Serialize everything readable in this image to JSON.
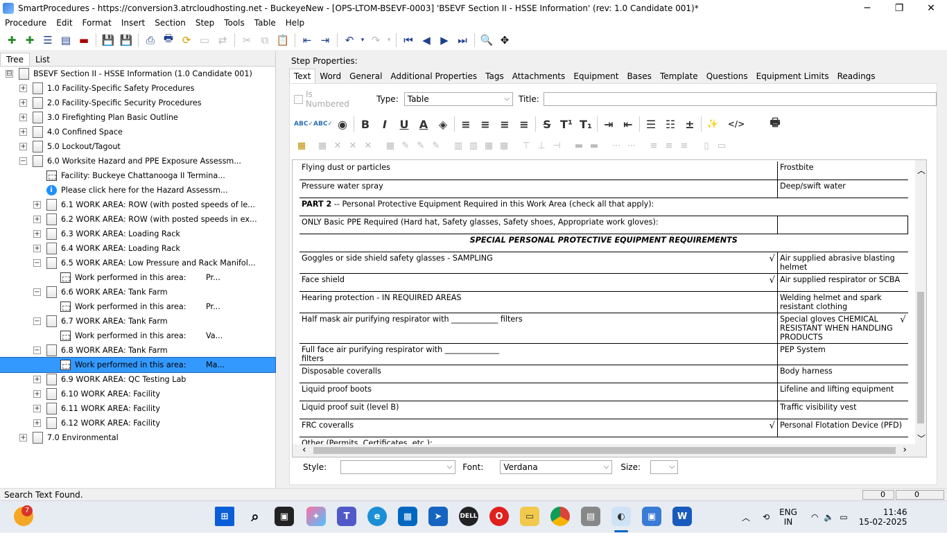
{
  "window": {
    "title": "SmartProcedures - https://conversion3.atrcloudhosting.net - BuckeyeNew - [OPS-LTOM-BSEVF-0003] 'BSEVF Section II - HSSE Information' (rev: 1.0 Candidate 001)*",
    "minimize": "─",
    "restore": "❐",
    "close": "✕"
  },
  "menu": [
    "Procedure",
    "Edit",
    "Format",
    "Insert",
    "Section",
    "Step",
    "Tools",
    "Table",
    "Help"
  ],
  "left_tabs": [
    "Tree",
    "List"
  ],
  "tree": [
    {
      "label": "BSEVF Section II - HSSE Information (1.0 Candidate 001)",
      "level": 0,
      "exp": "⊟",
      "icon": "doc"
    },
    {
      "label": "1.0 Facility-Specific Safety Procedures",
      "level": 1,
      "exp": "+",
      "icon": "doc"
    },
    {
      "label": "2.0 Facility-Specific Security Procedures",
      "level": 1,
      "exp": "+",
      "icon": "doc"
    },
    {
      "label": "3.0 Firefighting Plan Basic Outline",
      "level": 1,
      "exp": "+",
      "icon": "doc"
    },
    {
      "label": "4.0 Confined Space",
      "level": 1,
      "exp": "+",
      "icon": "doc"
    },
    {
      "label": "5.0 Lockout/Tagout",
      "level": 1,
      "exp": "+",
      "icon": "doc"
    },
    {
      "label": "6.0 Worksite Hazard and PPE Exposure Assessm...",
      "level": 1,
      "exp": "−",
      "icon": "doc"
    },
    {
      "label": "Facility: Buckeye Chattanooga II Termina...",
      "level": 2,
      "exp": "",
      "icon": "step"
    },
    {
      "label": "Please click here for the Hazard Assessm...",
      "level": 2,
      "exp": "",
      "icon": "info"
    },
    {
      "label": "6.1 WORK AREA: ROW (with posted speeds of le...",
      "level": 2,
      "exp": "+",
      "icon": "doc"
    },
    {
      "label": "6.2 WORK AREA: ROW (with posted speeds in ex...",
      "level": 2,
      "exp": "+",
      "icon": "doc"
    },
    {
      "label": "6.3 WORK AREA: Loading Rack",
      "level": 2,
      "exp": "+",
      "icon": "doc"
    },
    {
      "label": "6.4 WORK AREA: Loading Rack",
      "level": 2,
      "exp": "+",
      "icon": "doc"
    },
    {
      "label": "6.5 WORK AREA: Low Pressure and Rack Manifol...",
      "level": 2,
      "exp": "−",
      "icon": "doc"
    },
    {
      "label": "Work performed in this area:        Pr...",
      "level": 3,
      "exp": "",
      "icon": "step"
    },
    {
      "label": "6.6 WORK AREA: Tank Farm",
      "level": 2,
      "exp": "−",
      "icon": "doc"
    },
    {
      "label": "Work performed in this area:        Pr...",
      "level": 3,
      "exp": "",
      "icon": "step"
    },
    {
      "label": "6.7 WORK AREA: Tank Farm",
      "level": 2,
      "exp": "−",
      "icon": "doc"
    },
    {
      "label": "Work performed in this area:        Va...",
      "level": 3,
      "exp": "",
      "icon": "step"
    },
    {
      "label": "6.8 WORK AREA: Tank Farm",
      "level": 2,
      "exp": "−",
      "icon": "doc"
    },
    {
      "label": "Work performed in this area:        Ma...",
      "level": 3,
      "exp": "",
      "icon": "step",
      "selected": true
    },
    {
      "label": "6.9 WORK AREA: QC Testing Lab",
      "level": 2,
      "exp": "+",
      "icon": "doc"
    },
    {
      "label": "6.10 WORK AREA: Facility",
      "level": 2,
      "exp": "+",
      "icon": "doc"
    },
    {
      "label": "6.11 WORK AREA: Facility",
      "level": 2,
      "exp": "+",
      "icon": "doc"
    },
    {
      "label": "6.12 WORK AREA: Facility",
      "level": 2,
      "exp": "+",
      "icon": "doc"
    },
    {
      "label": "7.0 Environmental",
      "level": 1,
      "exp": "+",
      "icon": "doc"
    }
  ],
  "step_properties": {
    "heading": "Step Properties:",
    "tabs": [
      "Text",
      "Word",
      "General",
      "Additional Properties",
      "Tags",
      "Attachments",
      "Equipment",
      "Bases",
      "Template",
      "Questions",
      "Equipment Limits",
      "Readings"
    ],
    "is_numbered_label": "Is Numbered",
    "type_label": "Type:",
    "type_value": "Table",
    "title_label": "Title:",
    "title_value": ""
  },
  "format_toolbar": {
    "buttons": [
      "ABC✓",
      "ABC✓",
      "◉",
      "B",
      "I",
      "U",
      "A",
      "◈",
      "≡",
      "≡",
      "≡",
      "≡",
      "S",
      "T¹",
      "T₁",
      "⇥",
      "⇤",
      "☰",
      "☷",
      "±",
      "✨",
      "</>",
      "🖶"
    ]
  },
  "document": {
    "rows": [
      {
        "left": "Flying dust or particles",
        "left_check": "",
        "right": "Frostbite",
        "right_check": ""
      },
      {
        "left": "Pressure water spray",
        "left_check": "",
        "right": "Deep/swift water",
        "right_check": ""
      },
      {
        "type": "span",
        "bold_prefix": "PART 2",
        "text": " -- Personal Protective Equipment Required in this Work Area (check all that apply):"
      },
      {
        "type": "basic",
        "text": "ONLY Basic PPE Required (Hard hat, Safety glasses, Safety shoes, Appropriate work gloves):"
      },
      {
        "type": "header",
        "text": "SPECIAL PERSONAL PROTECTIVE EQUIPMENT REQUIREMENTS"
      },
      {
        "left": "Goggles or side shield safety glasses - SAMPLING",
        "left_check": "√",
        "right": "Air supplied abrasive blasting helmet",
        "right_check": ""
      },
      {
        "left": "Face shield",
        "left_check": "√",
        "right": "Air supplied respirator or SCBA",
        "right_check": ""
      },
      {
        "left": "Hearing protection - IN REQUIRED AREAS",
        "left_check": "",
        "right": "Welding helmet and spark resistant clothing",
        "right_check": ""
      },
      {
        "left": "Half mask air purifying respirator with ____________ filters",
        "left_check": "",
        "right": "Special gloves  CHEMICAL RESISTANT WHEN HANDLING PRODUCTS",
        "right_check": "√"
      },
      {
        "left": "Full face air purifying respirator with ______________ filters",
        "left_check": "",
        "right": "PEP System",
        "right_check": ""
      },
      {
        "left": "Disposable coveralls",
        "left_check": "",
        "right": "Body harness",
        "right_check": ""
      },
      {
        "left": "Liquid proof boots",
        "left_check": "",
        "right": "Lifeline and lifting equipment",
        "right_check": ""
      },
      {
        "left": "Liquid proof suit (level B)",
        "left_check": "",
        "right": "Traffic visibility vest",
        "right_check": ""
      },
      {
        "left": "FRC coveralls",
        "left_check": "√",
        "right": "Personal Flotation Device (PFD)",
        "right_check": ""
      },
      {
        "type": "other",
        "text": "Other (Permits, Certificates, etc.): ___________________________________________________________________"
      }
    ]
  },
  "bottom": {
    "style_label": "Style:",
    "style_value": "",
    "font_label": "Font:",
    "font_value": "Verdana",
    "size_label": "Size:",
    "size_value": ""
  },
  "status_text": "Search Text Found.",
  "status_counters": [
    "0",
    "0"
  ],
  "taskbar": {
    "badge": "7",
    "lang": "ENG",
    "region": "IN",
    "time": "11:46",
    "date": "15-02-2025"
  },
  "colors": {
    "selection": "#3399ff",
    "toolbar_icon": "#1f3f8f"
  }
}
